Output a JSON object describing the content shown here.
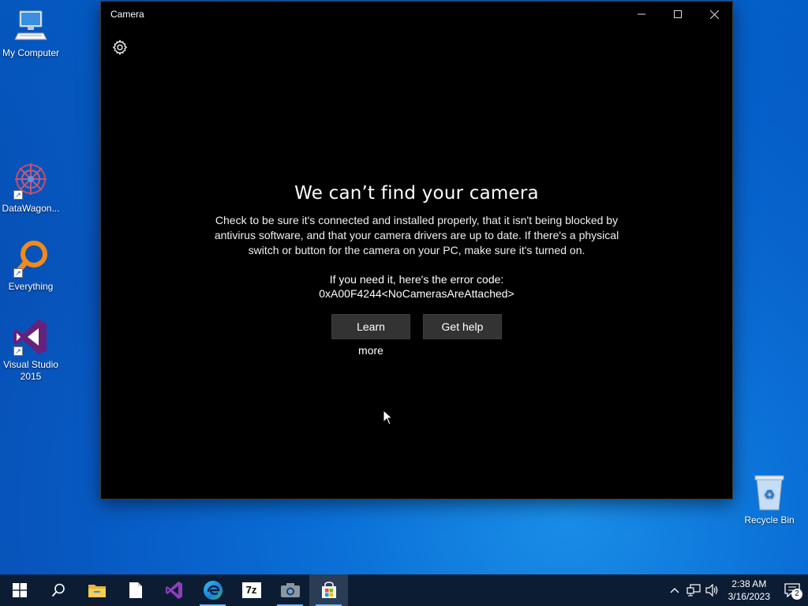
{
  "desktop": {
    "icons": [
      {
        "label": "My Computer"
      },
      {
        "label": "DataWagon..."
      },
      {
        "label": "Everything"
      },
      {
        "label": "Visual Studio 2015"
      },
      {
        "label": "Recycle Bin"
      }
    ]
  },
  "window": {
    "title": "Camera",
    "error": {
      "heading": "We can’t find your camera",
      "description": "Check to be sure it's connected and installed properly, that it isn't being blocked by antivirus software, and that your camera drivers are up to date. If there's a physical switch or button for the camera on your PC, make sure it's turned on.",
      "code_label": "If you need it, here's the error code:",
      "code": "0xA00F4244<NoCamerasAreAttached>"
    },
    "buttons": {
      "learn_more": "Learn more",
      "get_help": "Get help"
    }
  },
  "taskbar": {
    "apps": [
      "start-icon",
      "search-icon",
      "file-explorer-icon",
      "notepad-icon",
      "visual-studio-icon",
      "edge-icon",
      "7zip-icon",
      "camera-app-icon",
      "store-icon"
    ],
    "sevenzip_label": "7z",
    "clock": {
      "time": "2:38 AM",
      "date": "3/16/2023"
    },
    "notifications_count": "2"
  },
  "colors": {
    "desktop": "#0a6fd6",
    "window_bg": "#000000",
    "button_bg": "#333333",
    "taskbar": "#0c1d33"
  }
}
